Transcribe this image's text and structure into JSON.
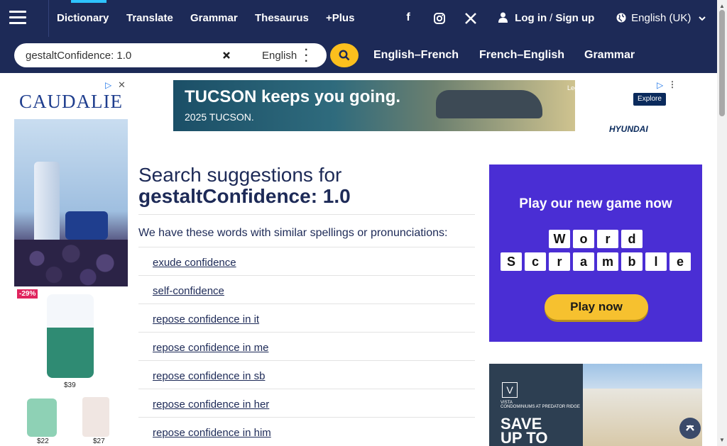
{
  "nav": {
    "items": [
      {
        "label": "Dictionary"
      },
      {
        "label": "Translate"
      },
      {
        "label": "Grammar"
      },
      {
        "label": "Thesaurus"
      },
      {
        "label": "+Plus"
      }
    ],
    "social": [
      "facebook-icon",
      "instagram-icon",
      "x-icon"
    ],
    "login": "Log in",
    "signup": "Sign up",
    "language": "English (UK)"
  },
  "search": {
    "value": "gestaltConfidence: 1.0",
    "dictionary": "English",
    "links": [
      "English–French",
      "French–English",
      "Grammar"
    ]
  },
  "main": {
    "title": "Search suggestions for",
    "query": "gestaltConfidence: 1.0",
    "intro": "We have these words with similar spellings or pronunciations:",
    "suggestions": [
      "exude confidence",
      "self-confidence",
      "repose confidence in it",
      "repose confidence in me",
      "repose confidence in sb",
      "repose confidence in her",
      "repose confidence in him"
    ]
  },
  "ads": {
    "left": {
      "brand": "CAUDALIE",
      "discount": "-29%",
      "prices": [
        "$39",
        "$22",
        "$27"
      ]
    },
    "top": {
      "headline": "TUCSON keeps you going.",
      "sub": "2025 TUCSON.",
      "legal": "Legal",
      "cta": "Explore",
      "brand": "HYUNDAI"
    },
    "game": {
      "headline": "Play our new game now",
      "row1": [
        "W",
        "o",
        "r",
        "d"
      ],
      "row2": [
        "S",
        "c",
        "r",
        "a",
        "m",
        "b",
        "l",
        "e"
      ],
      "cta": "Play now"
    },
    "bottom": {
      "brand": "VISTA",
      "brand_sub": "CONDOMINIUMS AT PREDATOR RIDGE",
      "line1": "SAVE",
      "line2": "UP TO"
    }
  },
  "colors": {
    "nav": "#1d2a57",
    "accent": "#fcbf1d",
    "game": "#4a2ed4"
  }
}
